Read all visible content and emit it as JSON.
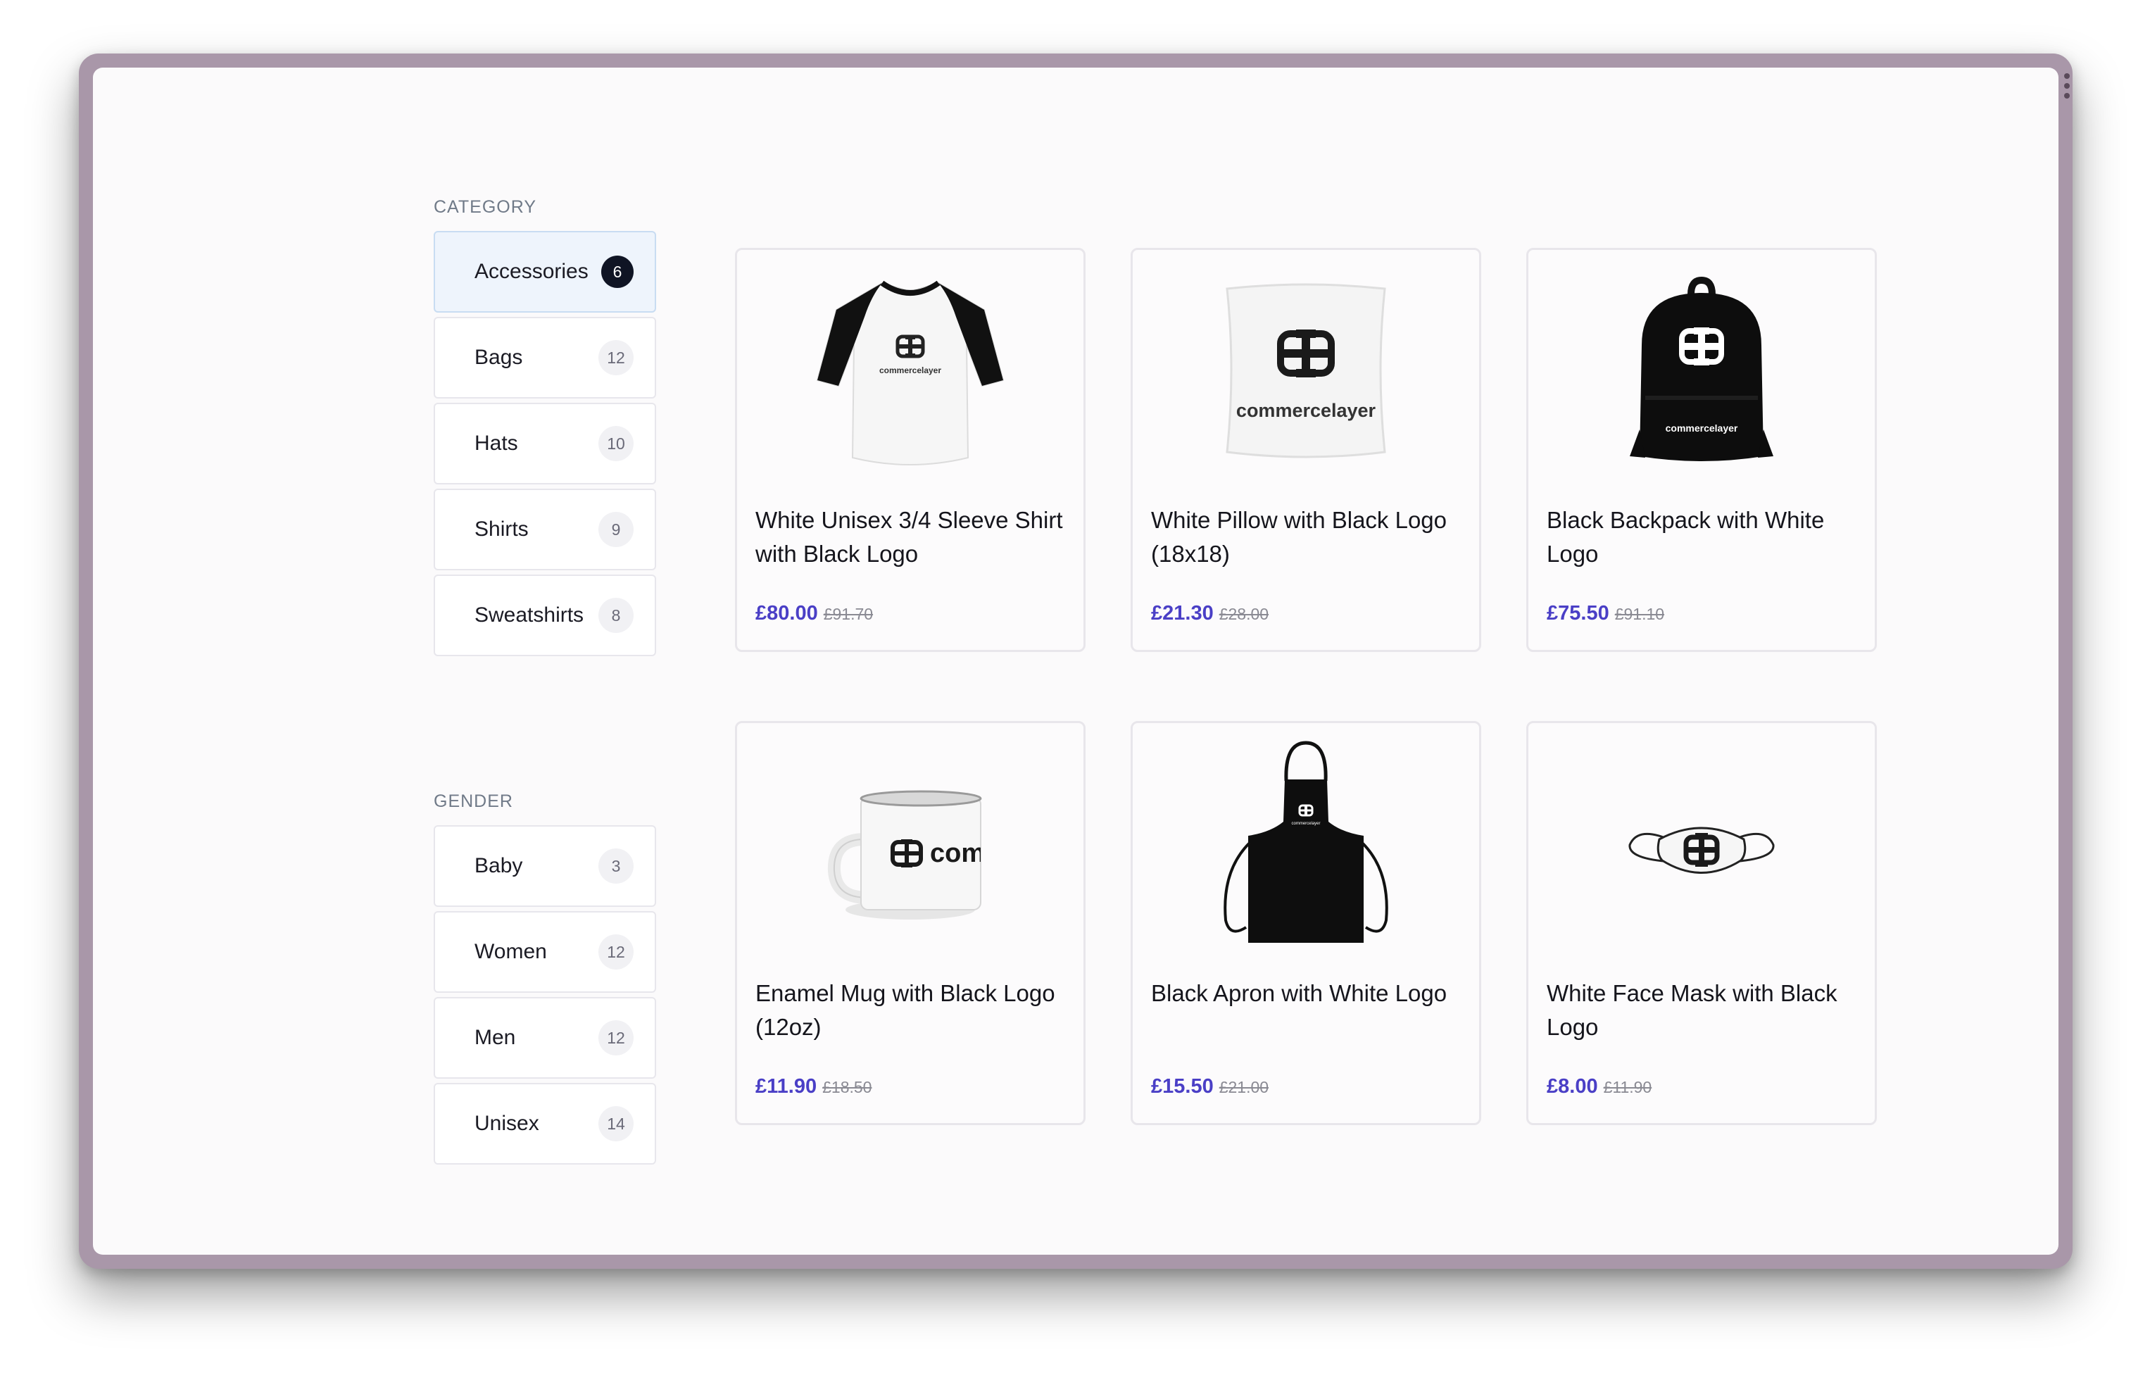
{
  "category": {
    "label": "CATEGORY",
    "items": [
      {
        "label": "Accessories",
        "count": "6",
        "active": true
      },
      {
        "label": "Bags",
        "count": "12"
      },
      {
        "label": "Hats",
        "count": "10"
      },
      {
        "label": "Shirts",
        "count": "9"
      },
      {
        "label": "Sweatshirts",
        "count": "8"
      }
    ]
  },
  "gender": {
    "label": "GENDER",
    "items": [
      {
        "label": "Baby",
        "count": "3"
      },
      {
        "label": "Women",
        "count": "12"
      },
      {
        "label": "Men",
        "count": "12"
      },
      {
        "label": "Unisex",
        "count": "14"
      }
    ]
  },
  "products": [
    {
      "title": "White Unisex 3/4 Sleeve Shirt with Black Logo",
      "price": "£80.00",
      "old_price": "£91.70",
      "image": "raglan-shirt",
      "logo_text": "commercelayer"
    },
    {
      "title": "White Pillow with Black Logo (18x18)",
      "price": "£21.30",
      "old_price": "£28.00",
      "image": "pillow",
      "logo_text": "commercelayer"
    },
    {
      "title": "Black Backpack with White Logo",
      "price": "£75.50",
      "old_price": "£91.10",
      "image": "backpack",
      "logo_text": "commercelayer"
    },
    {
      "title": "Enamel Mug with Black Logo (12oz)",
      "price": "£11.90",
      "old_price": "£18.50",
      "image": "mug",
      "logo_text": "comm"
    },
    {
      "title": "Black Apron with White Logo",
      "price": "£15.50",
      "old_price": "£21.00",
      "image": "apron",
      "logo_text": "commercelayer"
    },
    {
      "title": "White Face Mask with Black Logo",
      "price": "£8.00",
      "old_price": "£11.90",
      "image": "face-mask"
    }
  ],
  "colors": {
    "accent": "#4a3fc6",
    "active_filter_bg": "#eef4fc",
    "frame": "#a997a9"
  }
}
